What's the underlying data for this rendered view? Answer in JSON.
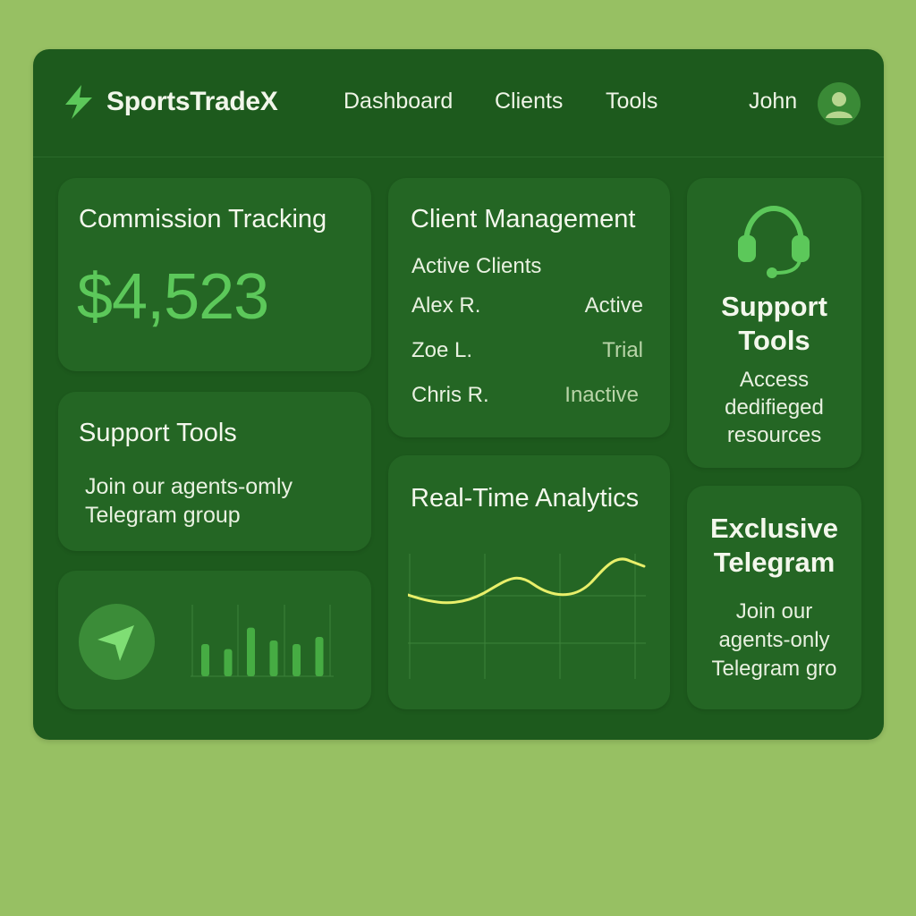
{
  "header": {
    "brand": "SportsTradeX",
    "nav": [
      "Dashboard",
      "Clients",
      "Tools"
    ],
    "user_name": "John"
  },
  "commission": {
    "title": "Commission Tracking",
    "amount": "$4,523"
  },
  "support_left": {
    "title": "Support Tools",
    "line1": "Join our agents-omly",
    "line2": "Telegram group"
  },
  "clients": {
    "title": "Client Management",
    "subtitle": "Active Clients",
    "rows": [
      {
        "name": "Alex R.",
        "status": "Active"
      },
      {
        "name": "Zoe L.",
        "status": "Trial"
      },
      {
        "name": "Chris R.",
        "status": "Inactive"
      }
    ]
  },
  "analytics": {
    "title": "Real-Time Analytics"
  },
  "support_right": {
    "title_line1": "Support",
    "title_line2": "Tools",
    "desc_line1": "Access",
    "desc_line2": "dedifieged",
    "desc_line3": "resources"
  },
  "telegram": {
    "title_line1": "Exclusive",
    "title_line2": "Telegram",
    "desc_line1": "Join our",
    "desc_line2": "agents-only",
    "desc_line3": "Telegram gro"
  },
  "mini_bars": {
    "values": [
      0.45,
      0.38,
      0.68,
      0.5,
      0.45,
      0.55
    ]
  },
  "colors": {
    "background": "#97c063",
    "panel": "#1d5a1d",
    "card": "#246624",
    "accent_green": "#5cc85a",
    "line_yellow": "#e8ef6a"
  },
  "icons": {
    "logo": "lightning-bolt-icon",
    "avatar": "user-avatar-icon",
    "headset": "headset-icon",
    "telegram": "telegram-send-icon"
  }
}
